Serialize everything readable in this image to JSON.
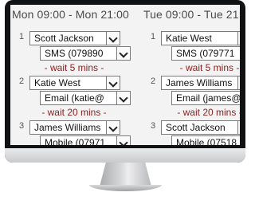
{
  "columns": [
    {
      "header": "Mon 09:00 - Mon 21:00",
      "entries": [
        {
          "number": "1",
          "person": "Scott Jackson",
          "contact": "SMS (079890",
          "wait": "- wait 5 mins -"
        },
        {
          "number": "2",
          "person": "Katie West",
          "contact": "Email (katie@",
          "wait": "- wait 20 mins -"
        },
        {
          "number": "3",
          "person": "James Williams",
          "contact": "Mobile (07971",
          "wait": ""
        }
      ]
    },
    {
      "header": "Tue 09:00 - Tue 21:00",
      "entries": [
        {
          "number": "1",
          "person": "Katie West",
          "contact": "SMS (079771",
          "wait": "- wait 5 mins -"
        },
        {
          "number": "2",
          "person": "James Williams",
          "contact": "Email (james@",
          "wait": "- wait 20 mins -"
        },
        {
          "number": "3",
          "person": "Scott Jackson",
          "contact": "Mobile (07518",
          "wait": ""
        }
      ]
    }
  ],
  "icons": {
    "dropdown": "chevron-down-icon"
  },
  "colors": {
    "wait_text": "#8a1f1f",
    "screen_bg": "#f3f3f3",
    "bezel": "#111214"
  }
}
